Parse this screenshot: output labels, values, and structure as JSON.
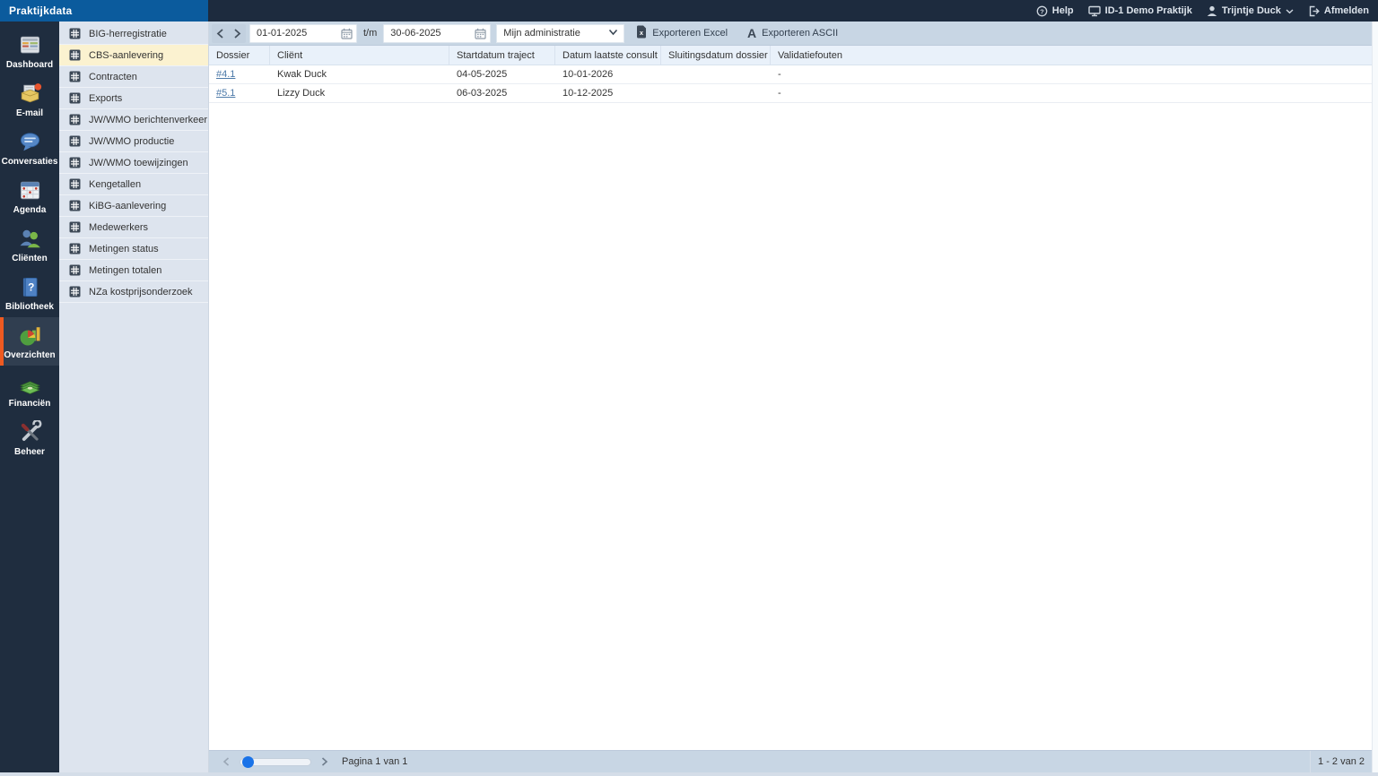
{
  "app": {
    "logo": "Praktijkdata"
  },
  "topbar": {
    "help": "Help",
    "practice": "ID-1 Demo Praktijk",
    "user": "Trijntje Duck",
    "logout": "Afmelden"
  },
  "rail": {
    "items": [
      {
        "label": "Dashboard",
        "icon": "dashboard-icon"
      },
      {
        "label": "E-mail",
        "icon": "email-icon"
      },
      {
        "label": "Conversaties",
        "icon": "speech-bubble-icon"
      },
      {
        "label": "Agenda",
        "icon": "calendar-icon"
      },
      {
        "label": "Cliënten",
        "icon": "people-icon"
      },
      {
        "label": "Bibliotheek",
        "icon": "book-icon"
      },
      {
        "label": "Overzichten",
        "icon": "pie-chart-icon"
      },
      {
        "label": "Financiën",
        "icon": "money-icon"
      },
      {
        "label": "Beheer",
        "icon": "tools-icon"
      }
    ],
    "selected": "Overzichten"
  },
  "sidebar": {
    "items": [
      {
        "label": "BIG-herregistratie"
      },
      {
        "label": "CBS-aanlevering"
      },
      {
        "label": "Contracten"
      },
      {
        "label": "Exports"
      },
      {
        "label": "JW/WMO berichtenverkeer"
      },
      {
        "label": "JW/WMO productie"
      },
      {
        "label": "JW/WMO toewijzingen"
      },
      {
        "label": "Kengetallen"
      },
      {
        "label": "KiBG-aanlevering"
      },
      {
        "label": "Medewerkers"
      },
      {
        "label": "Metingen status"
      },
      {
        "label": "Metingen totalen"
      },
      {
        "label": "NZa kostprijsonderzoek"
      }
    ],
    "selected": "CBS-aanlevering"
  },
  "toolbar": {
    "date_from": "01-01-2025",
    "range_separator": "t/m",
    "date_to": "30-06-2025",
    "administration": "Mijn administratie",
    "export_excel": "Exporteren Excel",
    "export_ascii": "Exporteren ASCII",
    "ascii_glyph": "A"
  },
  "table": {
    "columns": [
      "Dossier",
      "Cliënt",
      "Startdatum traject",
      "Datum laatste consult",
      "Sluitingsdatum dossier",
      "Validatiefouten"
    ],
    "rows": [
      {
        "dossier": "#4.1",
        "client": "Kwak Duck",
        "startdatum": "04-05-2025",
        "laatste_consult": "10-01-2026",
        "sluitingsdatum": "",
        "validatiefouten": "-"
      },
      {
        "dossier": "#5.1",
        "client": "Lizzy Duck",
        "startdatum": "06-03-2025",
        "laatste_consult": "10-12-2025",
        "sluitingsdatum": "",
        "validatiefouten": "-"
      }
    ]
  },
  "footer": {
    "page_label": "Pagina 1 van 1",
    "range_label": "1 - 2 van 2"
  },
  "colors": {
    "logo_blue": "#0b5b9d",
    "topbar_navy": "#1d2b3e",
    "rail_selected_accent": "#ee5a21",
    "sidebar_bg": "#dde4ee",
    "sidebar_selected": "#fbf2d0",
    "toolbar_bg": "#c8d6e4",
    "table_header_bg": "#e9f1fa",
    "link_blue": "#4d7aa9",
    "slider_knob_blue": "#1a73e8"
  }
}
